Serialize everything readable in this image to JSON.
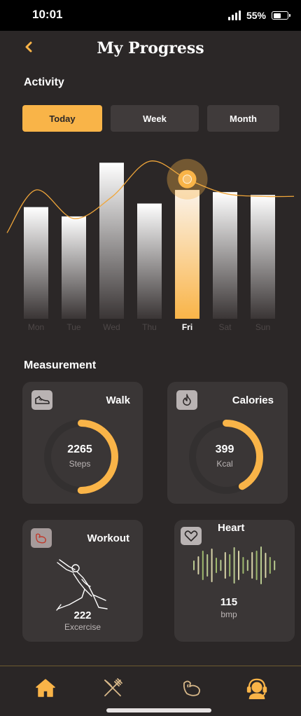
{
  "status_bar": {
    "time": "10:01",
    "battery": "55%",
    "battery_level": 0.55
  },
  "header": {
    "title": "My Progress",
    "back_icon": "chevron-left-icon"
  },
  "activity": {
    "title": "Activity",
    "tabs": [
      {
        "label": "Today",
        "active": true
      },
      {
        "label": "Week",
        "active": false
      },
      {
        "label": "Month",
        "active": false
      }
    ]
  },
  "chart_data": {
    "type": "bar",
    "categories": [
      "Mon",
      "Tue",
      "Wed",
      "Thu",
      "Fri",
      "Sat",
      "Sun"
    ],
    "values": [
      156,
      143,
      218,
      161,
      180,
      177,
      173
    ],
    "highlighted": "Fri",
    "trend_line": [
      120,
      180,
      140,
      170,
      220,
      195,
      175,
      171,
      171
    ],
    "ylim": [
      0,
      230
    ],
    "colors": {
      "bar_top": "#ffffff",
      "bar_bottom": "#3a3535",
      "highlight": "#f9b448",
      "line": "#f0a63a"
    }
  },
  "measurement": {
    "title": "Measurement",
    "walk": {
      "title": "Walk",
      "value": "2265",
      "unit": "Steps",
      "progress": 0.5,
      "icon": "sneaker-icon"
    },
    "calories": {
      "title": "Calories",
      "value": "399",
      "unit": "Kcal",
      "progress": 0.42,
      "icon": "flame-icon"
    },
    "workout": {
      "title": "Workout",
      "value": "222",
      "unit": "Excercise",
      "icon": "flexed-arm-icon"
    },
    "heart": {
      "title": "Heart",
      "value": "115",
      "unit": "bmp",
      "icon": "heart-icon"
    }
  },
  "nav": {
    "items": [
      {
        "icon": "home-icon",
        "active": true
      },
      {
        "icon": "fork-knife-icon",
        "active": false
      },
      {
        "icon": "flexed-arm-icon",
        "active": false
      },
      {
        "icon": "support-agent-icon",
        "active": false
      }
    ]
  },
  "accent": "#f9b448"
}
